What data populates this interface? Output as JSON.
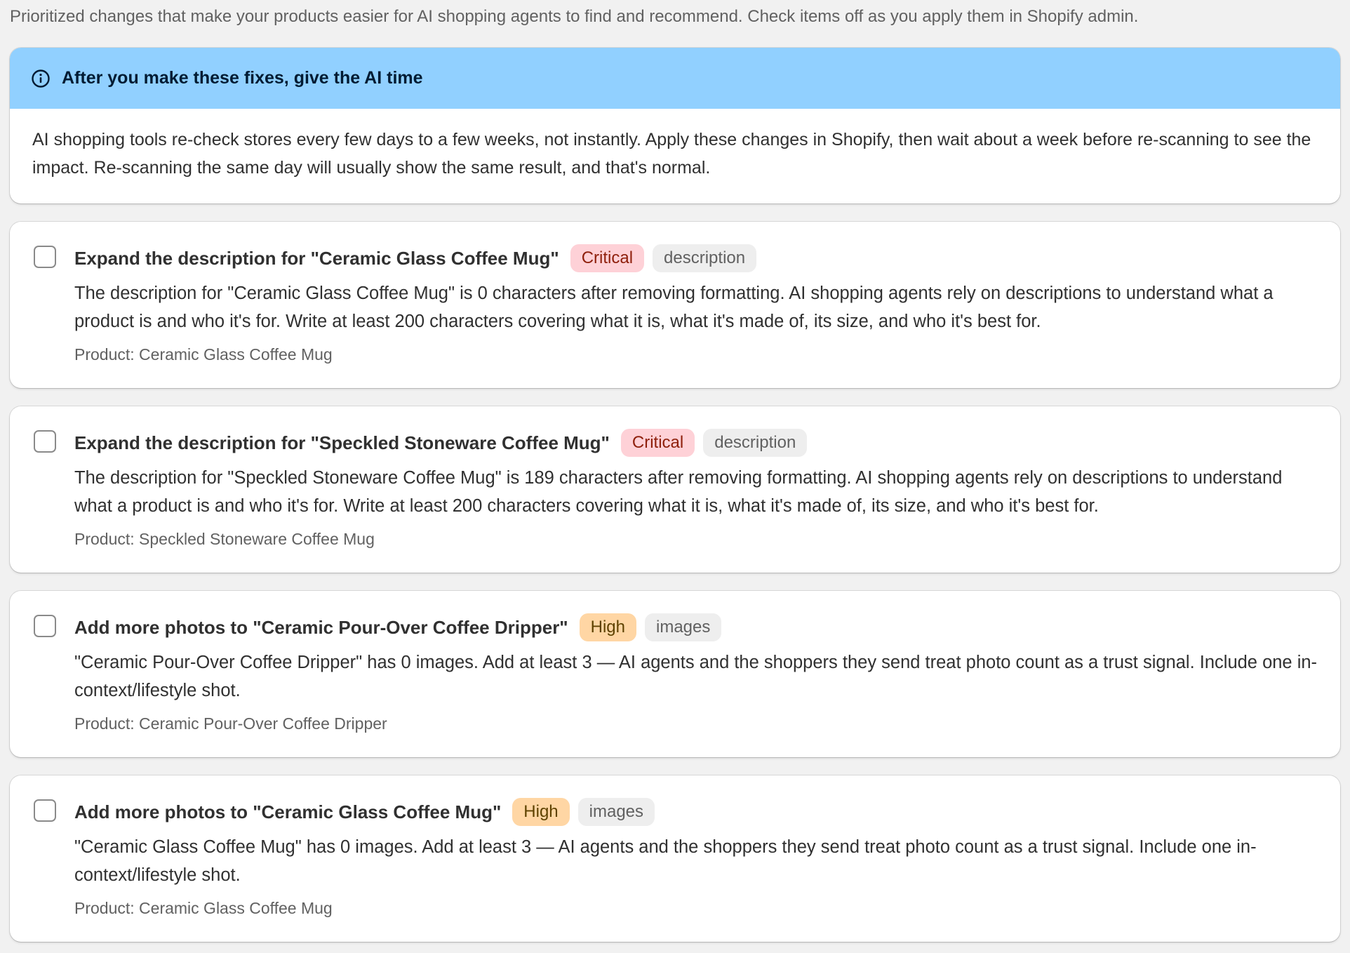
{
  "intro": "Prioritized changes that make your products easier for AI shopping agents to find and recommend. Check items off as you apply them in Shopify admin.",
  "banner": {
    "icon": "info-icon",
    "title": "After you make these fixes, give the AI time",
    "body": "AI shopping tools re-check stores every few days to a few weeks, not instantly. Apply these changes in Shopify, then wait about a week before re-scanning to see the impact. Re-scanning the same day will usually show the same result, and that's normal."
  },
  "colors": {
    "banner_header": "#91d0ff",
    "critical_bg": "#fed1d7",
    "critical_text": "#8e1f0b",
    "high_bg": "#ffd6a4",
    "high_text": "#5e4200",
    "tag_bg": "#eeeeee"
  },
  "items": [
    {
      "title": "Expand the description for \"Ceramic Glass Coffee Mug\"",
      "priority": "Critical",
      "tag": "description",
      "body": "The description for \"Ceramic Glass Coffee Mug\" is 0 characters after removing formatting. AI shopping agents rely on descriptions to understand what a product is and who it's for. Write at least 200 characters covering what it is, what it's made of, its size, and who it's best for.",
      "meta": "Product: Ceramic Glass Coffee Mug"
    },
    {
      "title": "Expand the description for \"Speckled Stoneware Coffee Mug\"",
      "priority": "Critical",
      "tag": "description",
      "body": "The description for \"Speckled Stoneware Coffee Mug\" is 189 characters after removing formatting. AI shopping agents rely on descriptions to understand what a product is and who it's for. Write at least 200 characters covering what it is, what it's made of, its size, and who it's best for.",
      "meta": "Product: Speckled Stoneware Coffee Mug"
    },
    {
      "title": "Add more photos to \"Ceramic Pour-Over Coffee Dripper\"",
      "priority": "High",
      "tag": "images",
      "body": "\"Ceramic Pour-Over Coffee Dripper\" has 0 images. Add at least 3 — AI agents and the shoppers they send treat photo count as a trust signal. Include one in-context/lifestyle shot.",
      "meta": "Product: Ceramic Pour-Over Coffee Dripper"
    },
    {
      "title": "Add more photos to \"Ceramic Glass Coffee Mug\"",
      "priority": "High",
      "tag": "images",
      "body": "\"Ceramic Glass Coffee Mug\" has 0 images. Add at least 3 — AI agents and the shoppers they send treat photo count as a trust signal. Include one in-context/lifestyle shot.",
      "meta": "Product: Ceramic Glass Coffee Mug"
    }
  ]
}
